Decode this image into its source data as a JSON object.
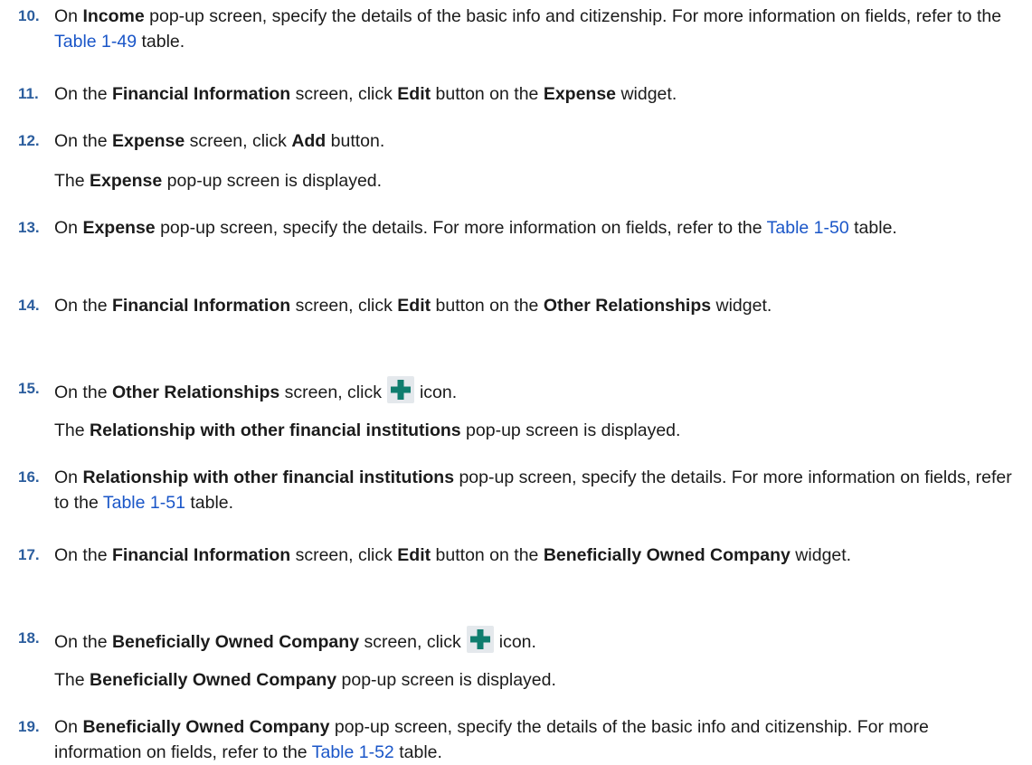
{
  "steps": [
    {
      "num": "10.",
      "segs": [
        {
          "t": "On "
        },
        {
          "t": "Income",
          "b": true
        },
        {
          "t": " pop-up screen, specify the details of the basic info and citizenship. For more information on fields, refer to the "
        },
        {
          "t": "Table 1-49",
          "link": true
        },
        {
          "t": " table."
        }
      ]
    },
    {
      "num": "11.",
      "segs": [
        {
          "t": "On the "
        },
        {
          "t": "Financial Information",
          "b": true
        },
        {
          "t": " screen, click "
        },
        {
          "t": "Edit",
          "b": true
        },
        {
          "t": " button on the "
        },
        {
          "t": "Expense",
          "b": true
        },
        {
          "t": " widget."
        }
      ]
    },
    {
      "num": "12.",
      "segs": [
        {
          "t": "On the "
        },
        {
          "t": "Expense",
          "b": true
        },
        {
          "t": " screen, click "
        },
        {
          "t": "Add",
          "b": true
        },
        {
          "t": " button."
        }
      ],
      "note": [
        {
          "t": "The "
        },
        {
          "t": "Expense",
          "b": true
        },
        {
          "t": " pop-up screen is displayed."
        }
      ]
    },
    {
      "num": "13.",
      "segs": [
        {
          "t": "On "
        },
        {
          "t": "Expense",
          "b": true
        },
        {
          "t": " pop-up screen, specify the details. For more information on fields, refer to the "
        },
        {
          "t": "Table 1-50",
          "link": true
        },
        {
          "t": " table."
        }
      ]
    },
    {
      "num": "14.",
      "segs": [
        {
          "t": "On the "
        },
        {
          "t": "Financial Information",
          "b": true
        },
        {
          "t": " screen, click "
        },
        {
          "t": "Edit",
          "b": true
        },
        {
          "t": " button on the "
        },
        {
          "t": "Other Relationships",
          "b": true
        },
        {
          "t": " widget."
        }
      ]
    },
    {
      "num": "15.",
      "segs": [
        {
          "t": "On the "
        },
        {
          "t": "Other Relationships",
          "b": true
        },
        {
          "t": " screen, click"
        },
        {
          "icon": "plus-icon"
        },
        {
          "t": "icon."
        }
      ],
      "note": [
        {
          "t": "The "
        },
        {
          "t": "Relationship with other financial institutions",
          "b": true
        },
        {
          "t": " pop-up screen is displayed."
        }
      ]
    },
    {
      "num": "16.",
      "segs": [
        {
          "t": "On "
        },
        {
          "t": "Relationship with other financial institutions",
          "b": true
        },
        {
          "t": " pop-up screen, specify the details. For more information on fields, refer to the "
        },
        {
          "t": "Table 1-51",
          "link": true
        },
        {
          "t": " table."
        }
      ]
    },
    {
      "num": "17.",
      "segs": [
        {
          "t": "On the "
        },
        {
          "t": "Financial Information",
          "b": true
        },
        {
          "t": " screen, click "
        },
        {
          "t": "Edit",
          "b": true
        },
        {
          "t": " button on the "
        },
        {
          "t": "Beneficially Owned Company",
          "b": true
        },
        {
          "t": " widget."
        }
      ]
    },
    {
      "num": "18.",
      "segs": [
        {
          "t": "On the "
        },
        {
          "t": "Beneficially Owned Company",
          "b": true
        },
        {
          "t": " screen, click"
        },
        {
          "icon": "plus-icon"
        },
        {
          "t": "icon."
        }
      ],
      "note": [
        {
          "t": "The "
        },
        {
          "t": "Beneficially Owned Company",
          "b": true
        },
        {
          "t": " pop-up screen is displayed."
        }
      ]
    },
    {
      "num": "19.",
      "segs": [
        {
          "t": "On "
        },
        {
          "t": "Beneficially Owned Company",
          "b": true
        },
        {
          "t": " pop-up screen, specify the details of the basic info and citizenship. For more information on fields, refer to the "
        },
        {
          "t": "Table 1-52",
          "link": true
        },
        {
          "t": " table."
        }
      ]
    }
  ],
  "colors": {
    "number": "#2c5e9e",
    "link": "#1a56c8",
    "icon_green": "#0f7d6e",
    "icon_bg": "#e4e8ec"
  }
}
